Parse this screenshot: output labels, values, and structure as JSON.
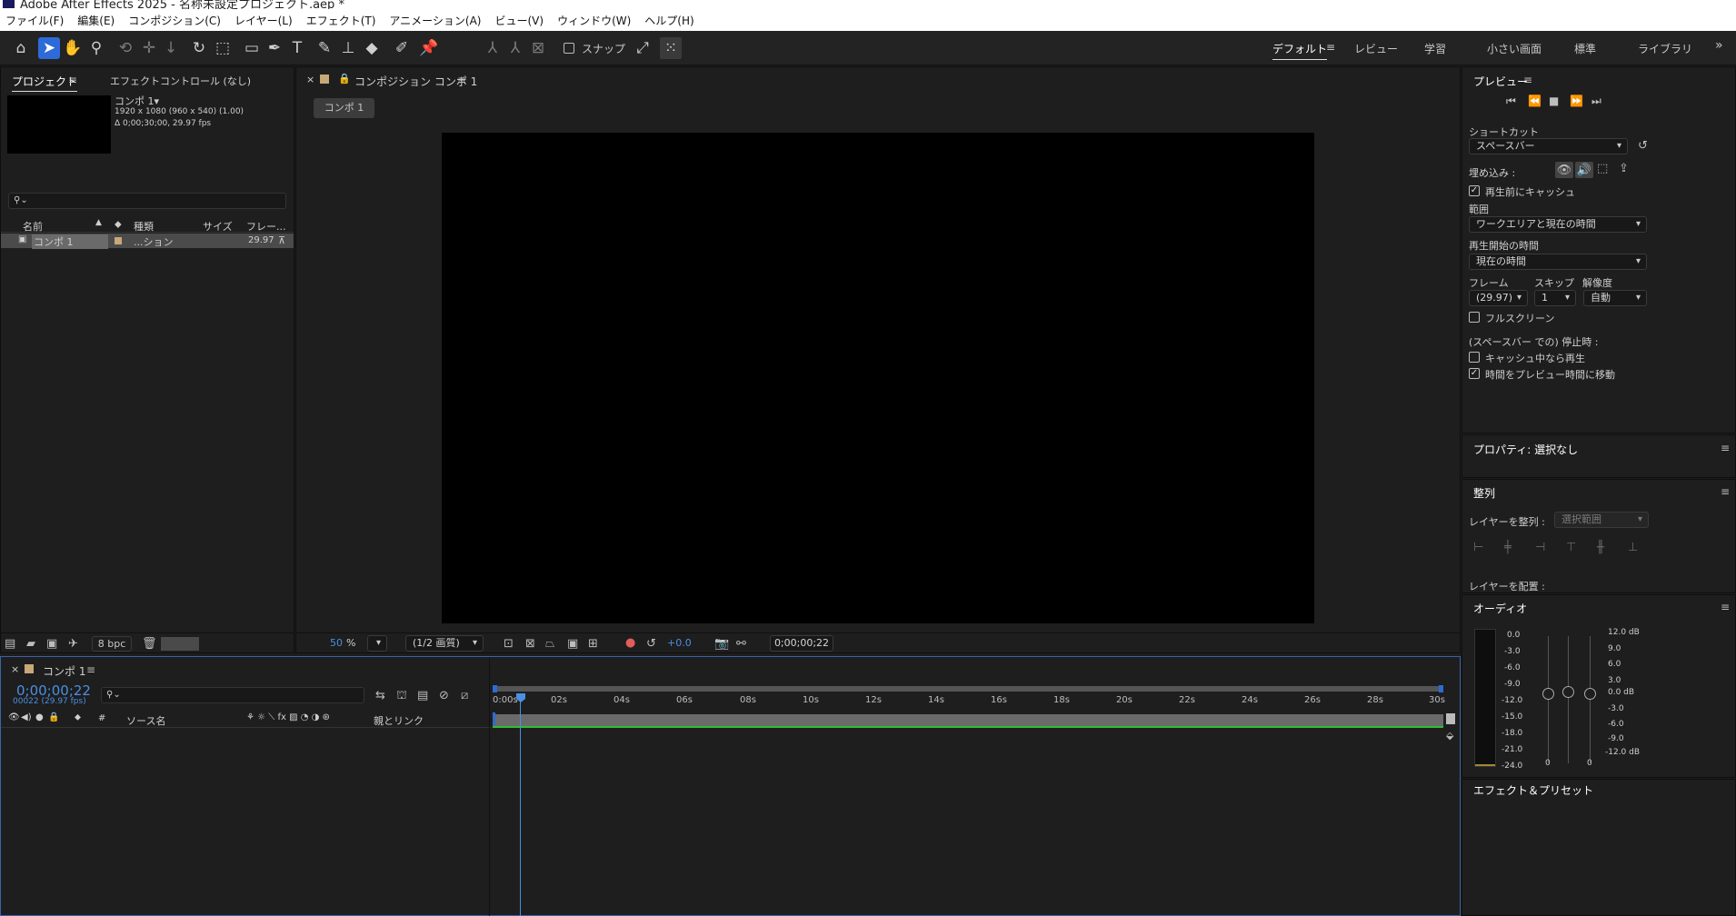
{
  "window": {
    "title": "Adobe After Effects 2025 - 名称未設定プロジェクト.aep *"
  },
  "menu": [
    "ファイル(F)",
    "編集(E)",
    "コンポジション(C)",
    "レイヤー(L)",
    "エフェクト(T)",
    "アニメーション(A)",
    "ビュー(V)",
    "ウィンドウ(W)",
    "ヘルプ(H)"
  ],
  "toolbar": {
    "snap_label": "スナップ",
    "workspaces": [
      "デフォルト",
      "レビュー",
      "学習",
      "小さい画面",
      "標準",
      "ライブラリ"
    ],
    "more": "»"
  },
  "project": {
    "tab_project": "プロジェクト",
    "tab_effects": "エフェクトコントロール (なし)",
    "comp_name": "コンポ 1▾",
    "comp_res": "1920 x 1080  (960 x 540) (1.00)",
    "comp_dur": "Δ 0;00;30;00, 29.97 fps",
    "search_icon": "⚲⌄",
    "columns": {
      "name": "名前",
      "type": "種類",
      "size": "サイズ",
      "frame": "フレー..."
    },
    "row": {
      "name": "コンポ 1",
      "type": "...ション",
      "fps": "29.97"
    },
    "bpc": "8 bpc"
  },
  "composition": {
    "tab_label": "コンポジション コンポ 1",
    "subtab": "コンポ 1",
    "zoom": "50",
    "zoom_unit": "%",
    "quality": "(1/2 画質)",
    "exposure": "+0.0",
    "timecode": "0;00;00;22"
  },
  "timeline": {
    "tab": "コンポ 1",
    "timecode": "0;00;00;22",
    "timecode_sub": "00022 (29.97 fps)",
    "search_icon": "⚲⌄",
    "col_source": "ソース名",
    "col_parent": "親とリンク",
    "col_hash": "#",
    "ruler": [
      "0:00s",
      "02s",
      "04s",
      "06s",
      "08s",
      "10s",
      "12s",
      "14s",
      "16s",
      "18s",
      "20s",
      "22s",
      "24s",
      "26s",
      "28s",
      "30s"
    ]
  },
  "preview": {
    "title": "プレビュー",
    "shortcut_label": "ショートカット",
    "shortcut_value": "スペースバー",
    "embed_label": "埋め込み :",
    "cache_label": "再生前にキャッシュ",
    "range_label": "範囲",
    "range_value": "ワークエリアと現在の時間",
    "start_label": "再生開始の時間",
    "start_value": "現在の時間",
    "frame_label": "フレーム",
    "skip_label": "スキップ",
    "res_label": "解像度",
    "frame_value": "(29.97)",
    "skip_value": "1",
    "res_value": "自動",
    "fullscreen_label": "フルスクリーン",
    "stop_label": "(スペースバー での) 停止時 :",
    "cache_play_label": "キャッシュ中なら再生",
    "move_time_label": "時間をプレビュー時間に移動"
  },
  "properties": {
    "title": "プロパティ: 選択なし"
  },
  "align": {
    "title": "整列",
    "align_to_label": "レイヤーを整列 :",
    "align_to_value": "選択範囲",
    "distribute_label": "レイヤーを配置 :"
  },
  "audio": {
    "title": "オーディオ",
    "left_scale": [
      "0.0",
      "-3.0",
      "-6.0",
      "-9.0",
      "-12.0",
      "-15.0",
      "-18.0",
      "-21.0",
      "-24.0"
    ],
    "right_scale": [
      "12.0 dB",
      "9.0",
      "6.0",
      "3.0",
      "0.0 dB",
      "-3.0",
      "-6.0",
      "-9.0",
      "-12.0 dB"
    ],
    "slider_values": [
      "0",
      "0"
    ]
  },
  "effects_presets": {
    "title": "エフェクト＆プリセット"
  },
  "colors": {
    "accent": "#2d6bd8",
    "timecode": "#4a90e2",
    "green_bar": "#2fbf2f"
  }
}
